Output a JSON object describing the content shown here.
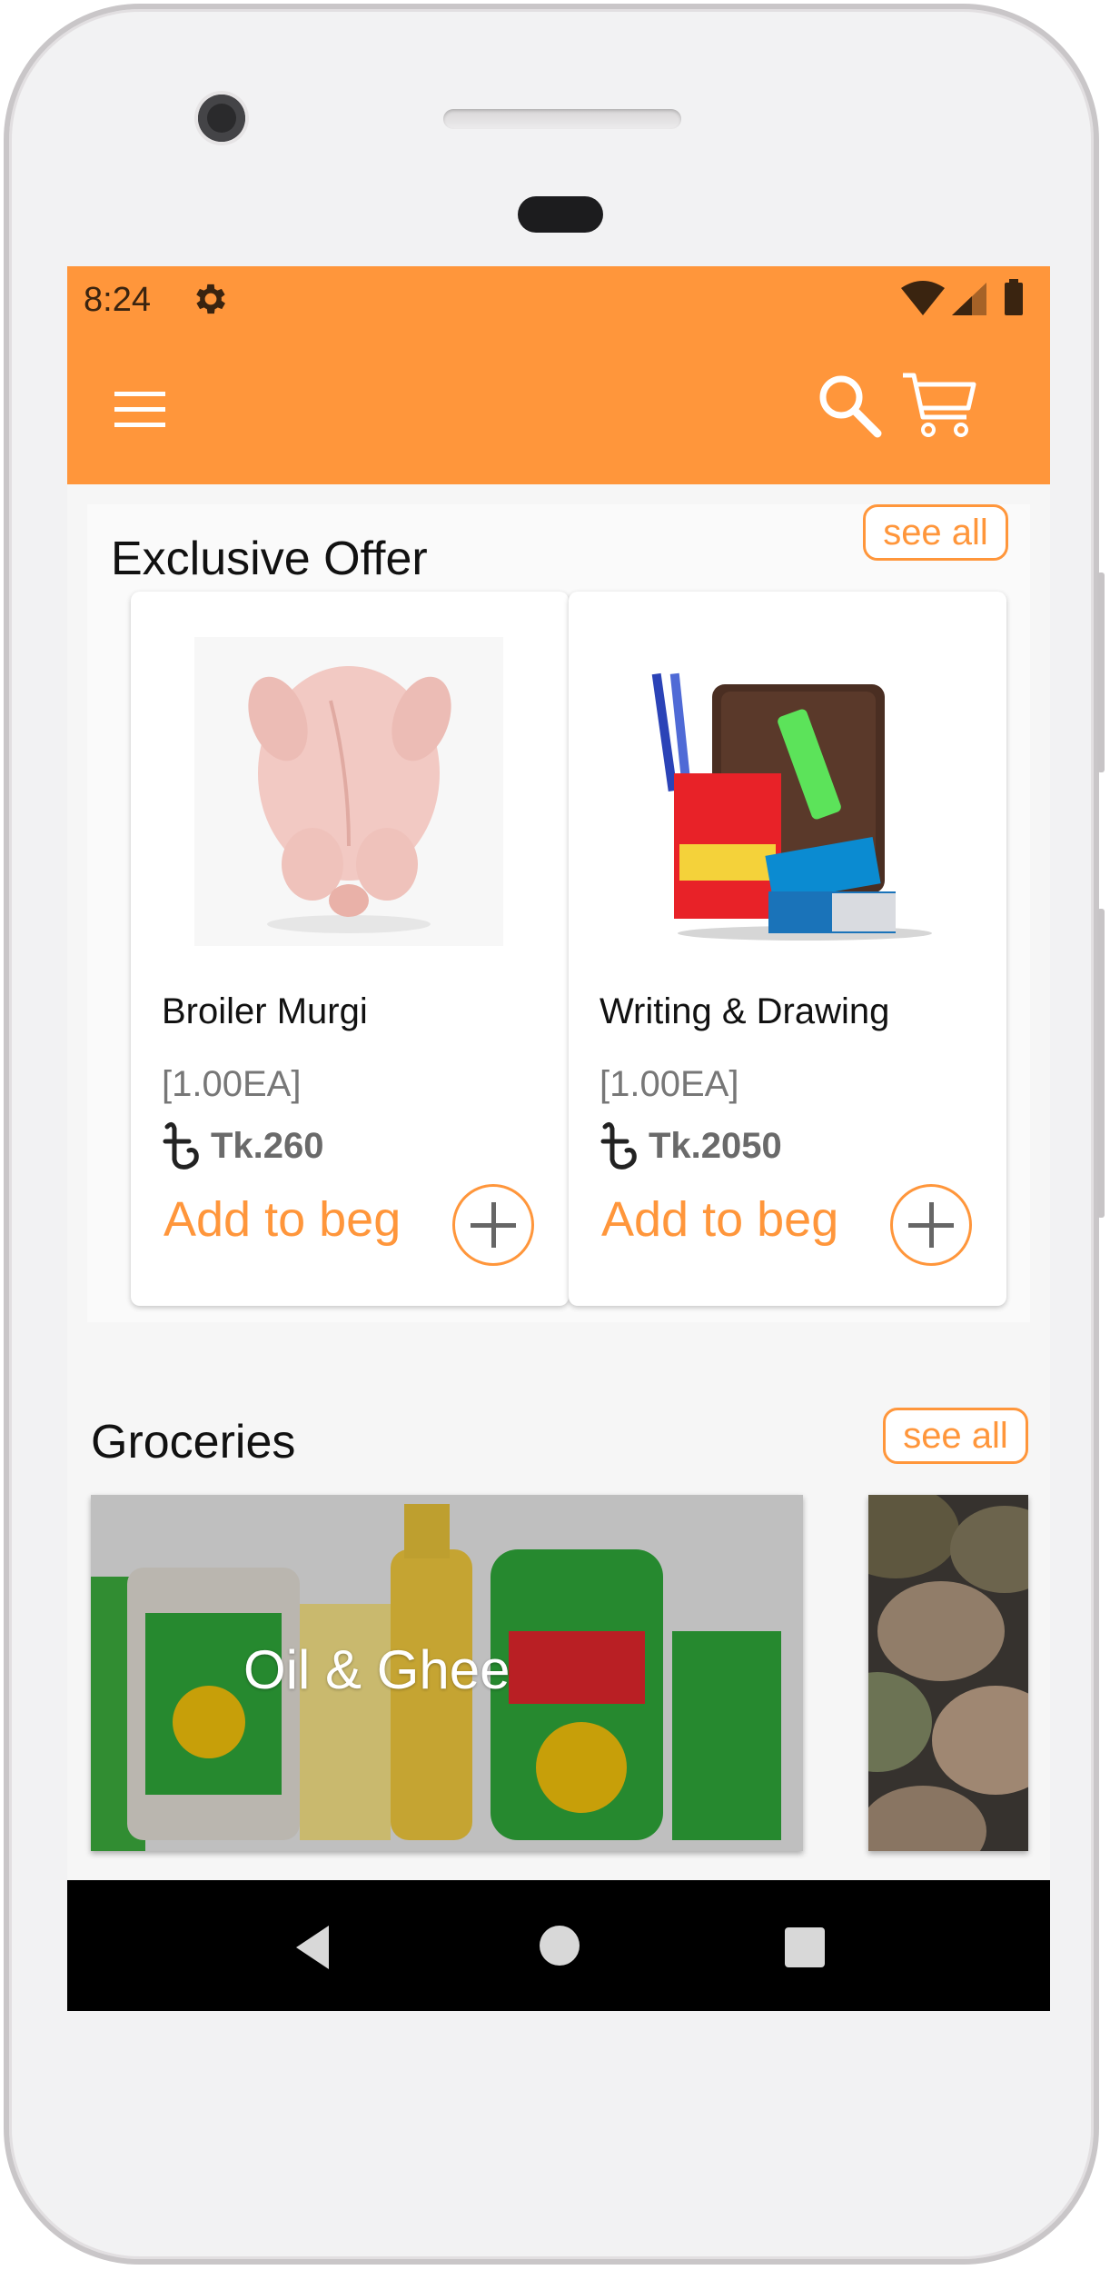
{
  "status_bar": {
    "time": "8:24",
    "icons": [
      "gear-icon",
      "wifi-icon",
      "signal-icon",
      "battery-icon"
    ]
  },
  "app_bar": {
    "icons": [
      "menu-icon",
      "search-icon",
      "cart-icon"
    ],
    "color": "#ff963b"
  },
  "exclusive_offer": {
    "title": "Exclusive Offer",
    "see_all": "see all",
    "products": [
      {
        "name": "Broiler Murgi",
        "qty": "[1.00EA]",
        "price": "Tk.260",
        "add_label": "Add to beg",
        "image": "chicken-image"
      },
      {
        "name": "Writing & Drawing",
        "qty": "[1.00EA]",
        "price": "Tk.2050",
        "add_label": "Add to beg",
        "image": "stationery-image"
      }
    ]
  },
  "groceries": {
    "title": "Groceries",
    "see_all": "see all",
    "categories": [
      {
        "label": "Oil & Ghee",
        "image": "oil-bottles-image"
      },
      {
        "label": "",
        "image": "lentils-image"
      }
    ]
  },
  "nav_bar": {
    "icons": [
      "back-icon",
      "home-icon",
      "recents-icon"
    ]
  },
  "colors": {
    "accent": "#ff963b",
    "price": "#6a6a6a"
  }
}
